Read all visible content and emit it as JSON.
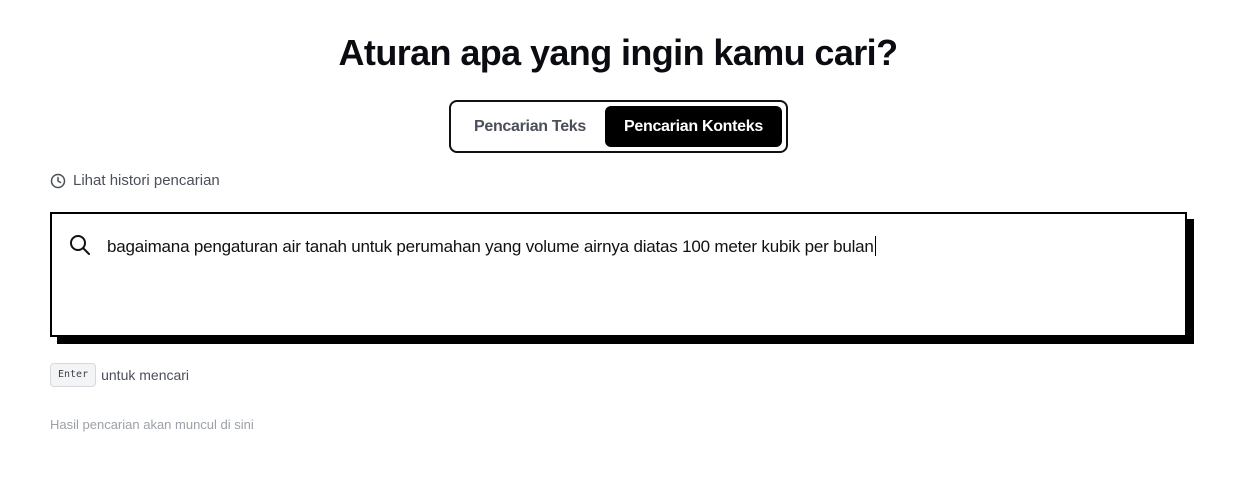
{
  "header": {
    "title": "Aturan apa yang ingin kamu cari?"
  },
  "search_mode": {
    "options": [
      {
        "label": "Pencarian Teks",
        "selected": false
      },
      {
        "label": "Pencarian Konteks",
        "selected": true
      }
    ]
  },
  "history": {
    "icon": "clock-icon",
    "label": "Lihat histori pencarian"
  },
  "search": {
    "icon": "search-icon",
    "value": "bagaimana pengaturan air tanah untuk perumahan yang volume airnya  diatas 100 meter kubik per bulan"
  },
  "hint": {
    "key": "Enter",
    "text": "untuk mencari"
  },
  "results": {
    "placeholder": "Hasil pencarian akan muncul di sini"
  }
}
